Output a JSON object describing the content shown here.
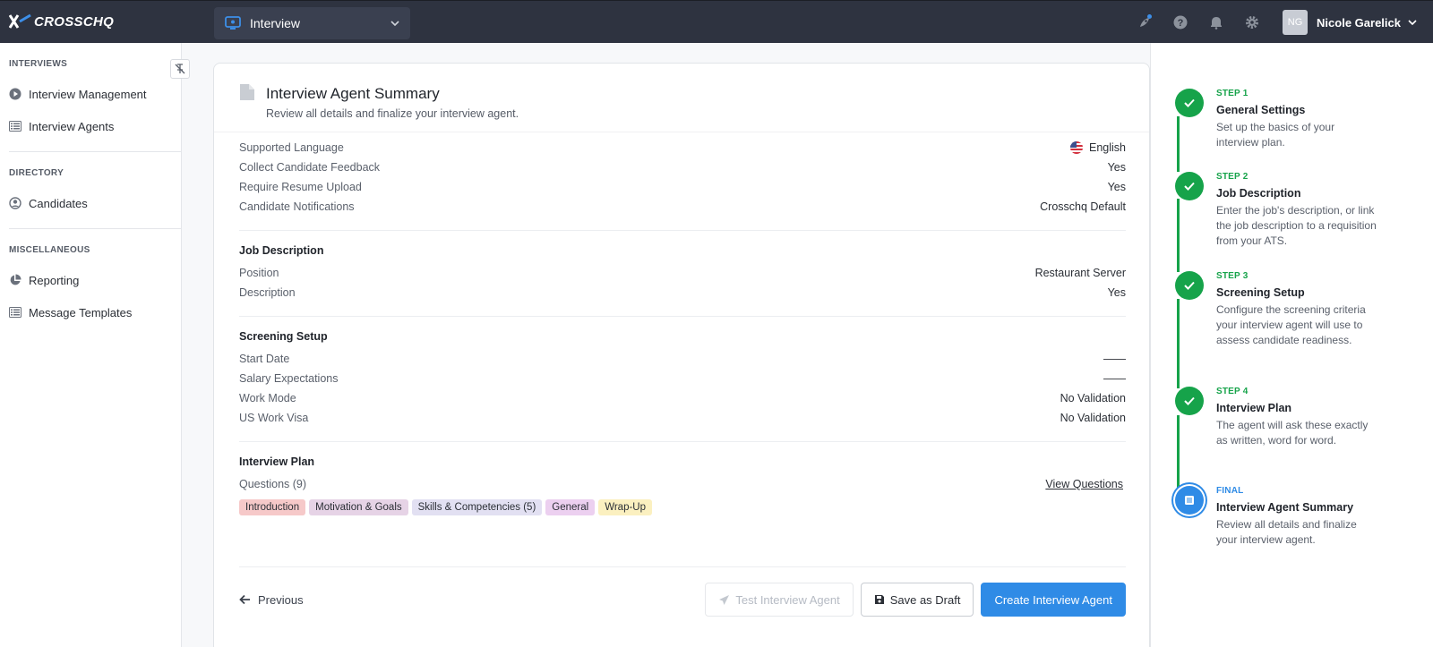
{
  "header": {
    "logo_text": "CROSSCHQ",
    "app_selector": "Interview",
    "user_initials": "NG",
    "user_name": "Nicole Garelick"
  },
  "sidebar": {
    "sections": [
      {
        "heading": "INTERVIEWS",
        "items": [
          "Interview Management",
          "Interview Agents"
        ]
      },
      {
        "heading": "DIRECTORY",
        "items": [
          "Candidates"
        ]
      },
      {
        "heading": "MISCELLANEOUS",
        "items": [
          "Reporting",
          "Message Templates"
        ]
      }
    ]
  },
  "summary": {
    "title": "Interview Agent Summary",
    "subtitle": "Review all details and finalize your interview agent.",
    "general": [
      {
        "label": "Supported Language",
        "value": "English"
      },
      {
        "label": "Collect Candidate Feedback",
        "value": "Yes"
      },
      {
        "label": "Require Resume Upload",
        "value": "Yes"
      },
      {
        "label": "Candidate Notifications",
        "value": "Crosschq Default"
      }
    ],
    "job_description": {
      "title": "Job Description",
      "rows": [
        {
          "label": "Position",
          "value": "Restaurant Server"
        },
        {
          "label": "Description",
          "value": "Yes"
        }
      ]
    },
    "screening": {
      "title": "Screening Setup",
      "rows": [
        {
          "label": "Start Date",
          "value": "——"
        },
        {
          "label": "Salary Expectations",
          "value": "——"
        },
        {
          "label": "Work Mode",
          "value": "No Validation"
        },
        {
          "label": "US Work Visa",
          "value": "No Validation"
        }
      ]
    },
    "plan": {
      "title": "Interview Plan",
      "questions_label": "Questions (9)",
      "view_link": "View Questions",
      "tags": [
        {
          "label": "Introduction",
          "color": "#f6c9c9"
        },
        {
          "label": "Motivation & Goals",
          "color": "#e6d3e6"
        },
        {
          "label": "Skills & Competencies (5)",
          "color": "#e2e0f2"
        },
        {
          "label": "General",
          "color": "#ecd0f0"
        },
        {
          "label": "Wrap-Up",
          "color": "#fbf0c0"
        }
      ]
    }
  },
  "footer": {
    "previous": "Previous",
    "test": "Test Interview Agent",
    "draft": "Save as Draft",
    "create": "Create Interview Agent"
  },
  "steps": [
    {
      "tag": "STEP 1",
      "name": "General Settings",
      "desc": "Set up the basics of your interview plan."
    },
    {
      "tag": "STEP 2",
      "name": "Job Description",
      "desc": "Enter the job's description, or link the job description to a requisition from your ATS."
    },
    {
      "tag": "STEP 3",
      "name": "Screening Setup",
      "desc": "Configure the screening criteria your interview agent will use to assess candidate readiness."
    },
    {
      "tag": "STEP 4",
      "name": "Interview Plan",
      "desc": "The agent will ask these exactly as written, word for word."
    },
    {
      "tag": "FINAL",
      "name": "Interview Agent Summary",
      "desc": "Review all details and finalize your interview agent."
    }
  ],
  "colors": {
    "accent": "#2f8be6",
    "success": "#16a34a",
    "topbar": "#2e3340"
  }
}
